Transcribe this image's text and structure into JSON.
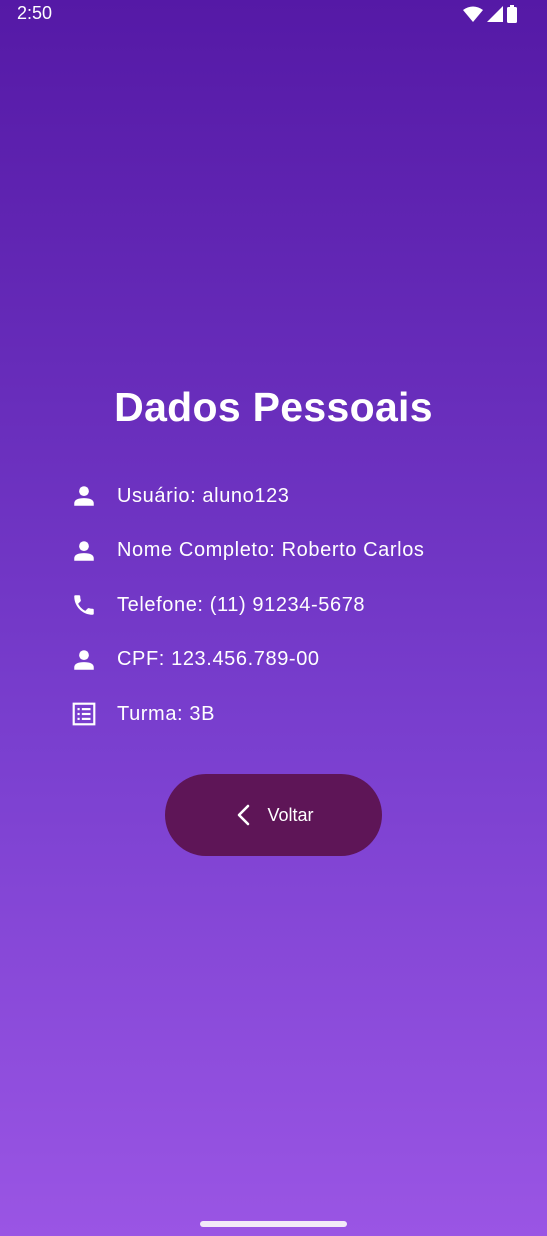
{
  "status_bar": {
    "time": "2:50",
    "icons": [
      "wifi-icon",
      "signal-icon",
      "battery-icon"
    ]
  },
  "page": {
    "title": "Dados Pessoais"
  },
  "info": [
    {
      "icon": "person-icon",
      "text": "Usuário: aluno123"
    },
    {
      "icon": "person-icon",
      "text": "Nome Completo: Roberto Carlos"
    },
    {
      "icon": "phone-icon",
      "text": "Telefone: (11) 91234-5678"
    },
    {
      "icon": "person-icon",
      "text": "CPF: 123.456.789-00"
    },
    {
      "icon": "list-icon",
      "text": "Turma: 3B"
    }
  ],
  "actions": {
    "back_label": "Voltar",
    "back_icon": "chevron-left-icon"
  },
  "colors": {
    "background_top": "#5519a6",
    "background_bottom": "#9a55e4",
    "button": "#5e1557",
    "text": "#ffffff"
  }
}
